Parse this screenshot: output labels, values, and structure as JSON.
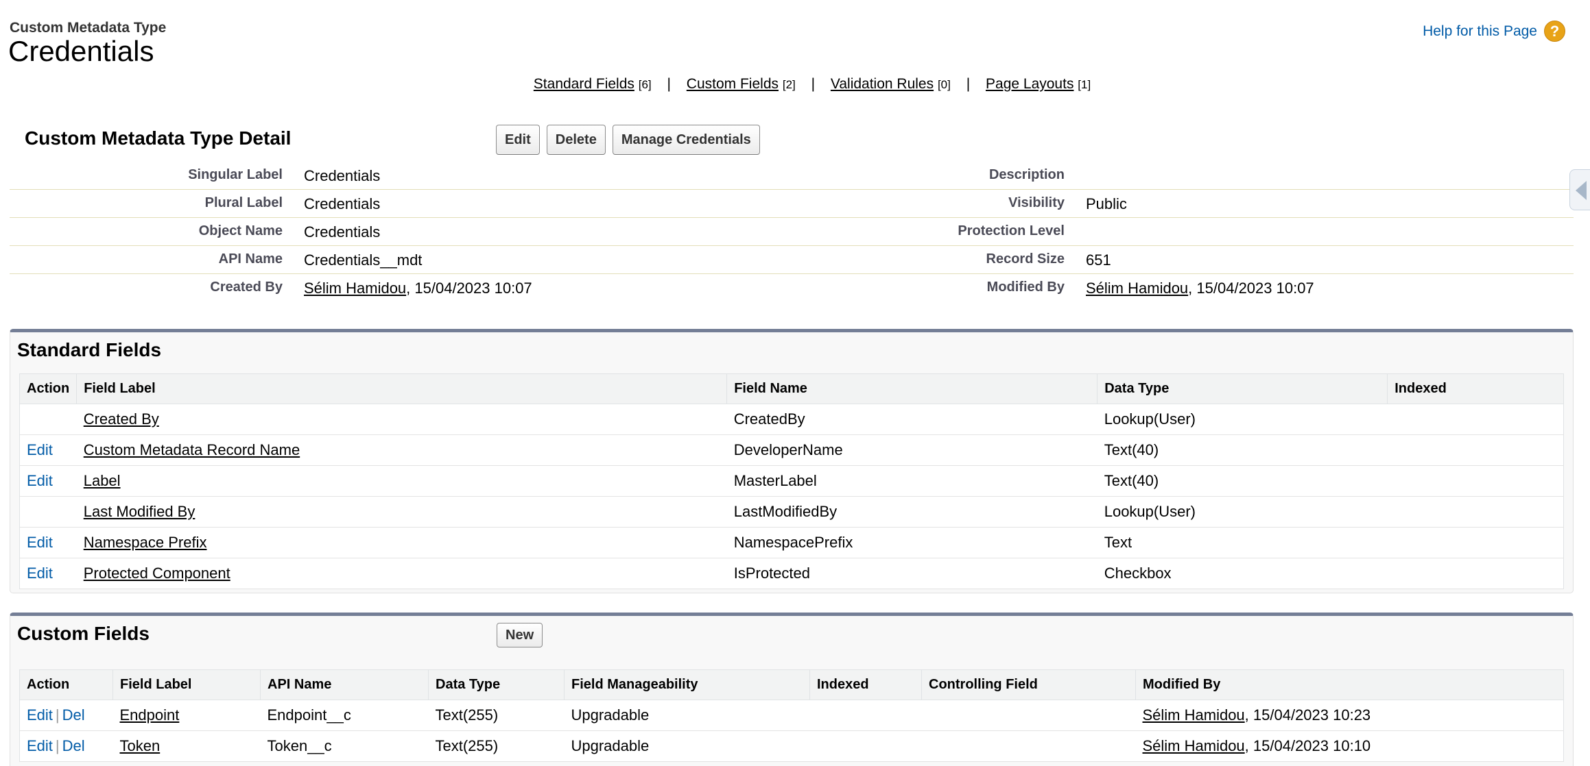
{
  "header": {
    "object_type": "Custom Metadata Type",
    "title": "Credentials",
    "help_link": "Help for this Page",
    "help_icon": "question-mark-icon"
  },
  "related_links": [
    {
      "label": "Standard Fields",
      "count": "[6]"
    },
    {
      "label": "Custom Fields",
      "count": "[2]"
    },
    {
      "label": "Validation Rules",
      "count": "[0]"
    },
    {
      "label": "Page Layouts",
      "count": "[1]"
    }
  ],
  "related_links_separator": "|",
  "detail": {
    "title": "Custom Metadata Type Detail",
    "buttons": {
      "edit": "Edit",
      "delete": "Delete",
      "manage": "Manage Credentials"
    },
    "rows": [
      {
        "left_label": "Singular Label",
        "left_value": "Credentials",
        "right_label": "Description",
        "right_value": ""
      },
      {
        "left_label": "Plural Label",
        "left_value": "Credentials",
        "right_label": "Visibility",
        "right_value": "Public"
      },
      {
        "left_label": "Object Name",
        "left_value": "Credentials",
        "right_label": "Protection Level",
        "right_value": ""
      },
      {
        "left_label": "API Name",
        "left_value": "Credentials__mdt",
        "right_label": "Record Size",
        "right_value": "651"
      }
    ],
    "created": {
      "label": "Created By",
      "user": "Sélim Hamidou",
      "date": ", 15/04/2023 10:07"
    },
    "modified": {
      "label": "Modified By",
      "user": "Sélim Hamidou",
      "date": ", 15/04/2023 10:07"
    }
  },
  "standard_fields": {
    "title": "Standard Fields",
    "columns": [
      "Action",
      "Field Label",
      "Field Name",
      "Data Type",
      "Indexed"
    ],
    "rows": [
      {
        "action": "",
        "label": "Created By",
        "name": "CreatedBy",
        "type": "Lookup(User)",
        "indexed": ""
      },
      {
        "action": "Edit",
        "label": "Custom Metadata Record Name",
        "name": "DeveloperName",
        "type": "Text(40)",
        "indexed": ""
      },
      {
        "action": "Edit",
        "label": "Label",
        "name": "MasterLabel",
        "type": "Text(40)",
        "indexed": ""
      },
      {
        "action": "",
        "label": "Last Modified By",
        "name": "LastModifiedBy",
        "type": "Lookup(User)",
        "indexed": ""
      },
      {
        "action": "Edit",
        "label": "Namespace Prefix",
        "name": "NamespacePrefix",
        "type": "Text",
        "indexed": ""
      },
      {
        "action": "Edit",
        "label": "Protected Component",
        "name": "IsProtected",
        "type": "Checkbox",
        "indexed": ""
      }
    ]
  },
  "custom_fields": {
    "title": "Custom Fields",
    "new_button": "New",
    "columns": [
      "Action",
      "Field Label",
      "API Name",
      "Data Type",
      "Field Manageability",
      "Indexed",
      "Controlling Field",
      "Modified By"
    ],
    "action_edit": "Edit",
    "action_del": "Del",
    "action_sep": "|",
    "rows": [
      {
        "label": "Endpoint",
        "api": "Endpoint__c",
        "type": "Text(255)",
        "manage": "Upgradable",
        "indexed": "",
        "controlling": "",
        "mod_user": "Sélim Hamidou",
        "mod_date": ", 15/04/2023 10:23"
      },
      {
        "label": "Token",
        "api": "Token__c",
        "type": "Text(255)",
        "manage": "Upgradable",
        "indexed": "",
        "controlling": "",
        "mod_user": "Sélim Hamidou",
        "mod_date": ", 15/04/2023 10:10"
      }
    ]
  }
}
